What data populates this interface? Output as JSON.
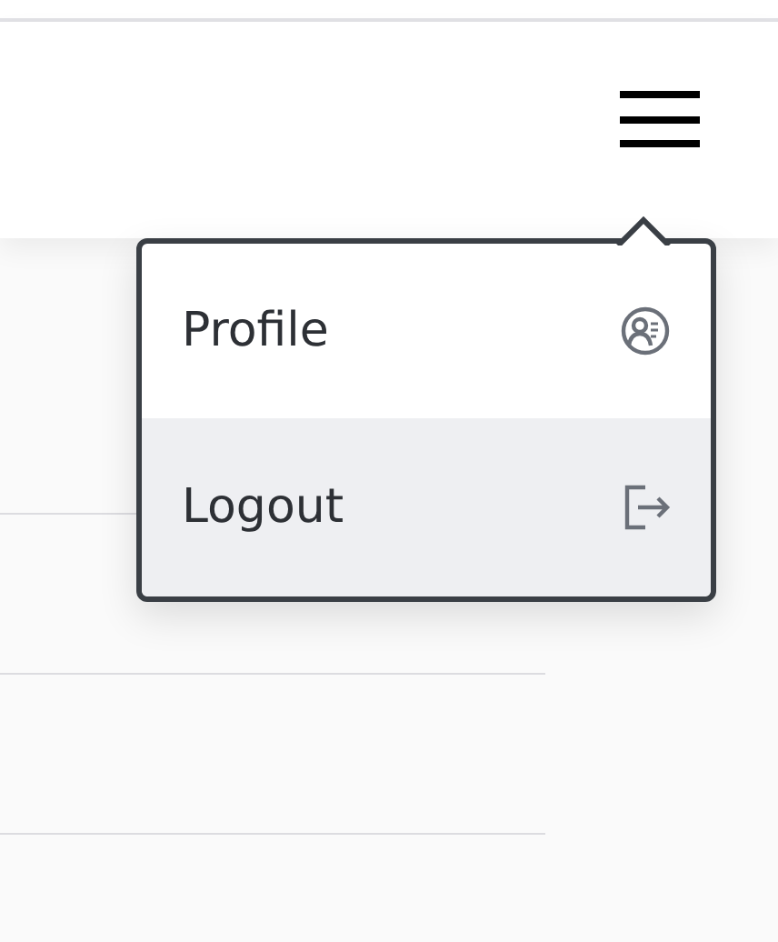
{
  "menu": {
    "items": [
      {
        "label": "Profile",
        "kind": "profile",
        "selected": false
      },
      {
        "label": "Logout",
        "kind": "logout",
        "selected": true
      }
    ]
  }
}
